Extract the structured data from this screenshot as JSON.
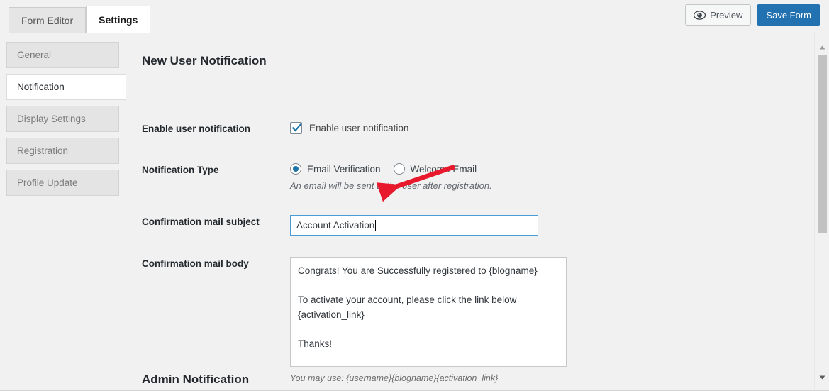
{
  "window": {
    "tabs": [
      {
        "label": "Form Editor",
        "active": false
      },
      {
        "label": "Settings",
        "active": true
      }
    ],
    "actions": {
      "preview_label": "Preview",
      "preview_icon": "eye-icon",
      "save_label": "Save Form",
      "save_color": "#2271b1"
    }
  },
  "sidebar": {
    "items": [
      {
        "label": "General",
        "active": false
      },
      {
        "label": "Notification",
        "active": true
      },
      {
        "label": "Display Settings",
        "active": false
      },
      {
        "label": "Registration",
        "active": false
      },
      {
        "label": "Profile Update",
        "active": false
      }
    ]
  },
  "main": {
    "section_title": "New User Notification",
    "next_section_title": "Admin Notification",
    "rows": {
      "enable": {
        "label": "Enable user notification",
        "checkbox_label": "Enable user notification",
        "checked": true
      },
      "type": {
        "label": "Notification Type",
        "options": [
          {
            "label": "Email Verification",
            "selected": true
          },
          {
            "label": "Welcome Email",
            "selected": false
          }
        ],
        "help": "An email will be sent to the user after registration."
      },
      "subject": {
        "label": "Confirmation mail subject",
        "value": "Account Activation",
        "placeholder": "",
        "focused": true
      },
      "body": {
        "label": "Confirmation mail body",
        "value": "Congrats! You are Successfully registered to {blogname}\n\nTo activate your account, please click the link below\n{activation_link}\n\nThanks!",
        "hint": "You may use: {username}{blogname}{activation_link}"
      }
    }
  },
  "annotation": {
    "type": "arrow",
    "color": "#e8192c",
    "points_to": "Confirmation mail subject input"
  },
  "scrollbar": {
    "up_arrow": "triangle-up-icon",
    "down_arrow": "triangle-down-icon",
    "thumb_color": "#c1c1c1"
  }
}
